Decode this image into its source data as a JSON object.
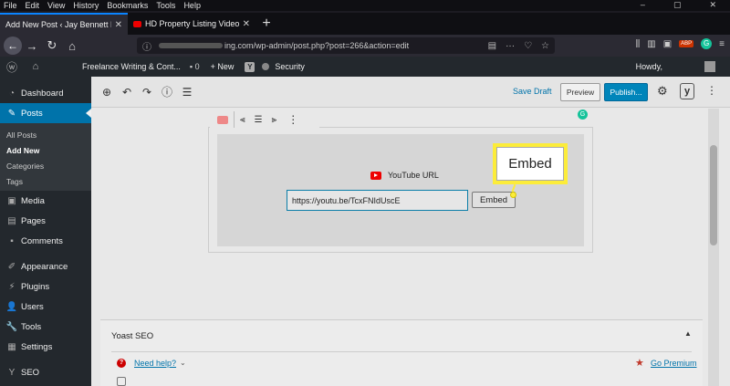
{
  "browser": {
    "menu": [
      "File",
      "Edit",
      "View",
      "History",
      "Bookmarks",
      "Tools",
      "Help"
    ],
    "window_controls": [
      "–",
      "▢",
      "✕"
    ],
    "tabs": [
      {
        "title": "Add New Post ‹ Jay Bennett Freela",
        "active": true
      },
      {
        "title": "HD Property Listing Video Tour",
        "active": false
      }
    ],
    "url": "ing.com/wp-admin/post.php?post=266&action=edit"
  },
  "adminbar": {
    "site": "Freelance Writing & Cont...",
    "comments": "0",
    "new": "New",
    "security": "Security",
    "howdy": "Howdy,"
  },
  "sidebar": {
    "dashboard": "Dashboard",
    "posts": "Posts",
    "subitems": [
      "All Posts",
      "Add New",
      "Categories",
      "Tags"
    ],
    "media": "Media",
    "pages": "Pages",
    "comments": "Comments",
    "appearance": "Appearance",
    "plugins": "Plugins",
    "users": "Users",
    "tools": "Tools",
    "settings": "Settings",
    "seo": "SEO"
  },
  "editor": {
    "save_draft": "Save Draft",
    "preview": "Preview",
    "publish": "Publish...",
    "embed_label": "YouTube URL",
    "embed_input_value": "https://youtu.be/TcxFNIdUscE",
    "embed_button": "Embed",
    "callout_label": "Embed"
  },
  "yoast": {
    "title": "Yoast SEO",
    "help": "Need help?",
    "premium": "Go Premium"
  },
  "colors": {
    "accent": "#0073aa",
    "callout": "#fcec3a",
    "publish": "#0085ba"
  }
}
